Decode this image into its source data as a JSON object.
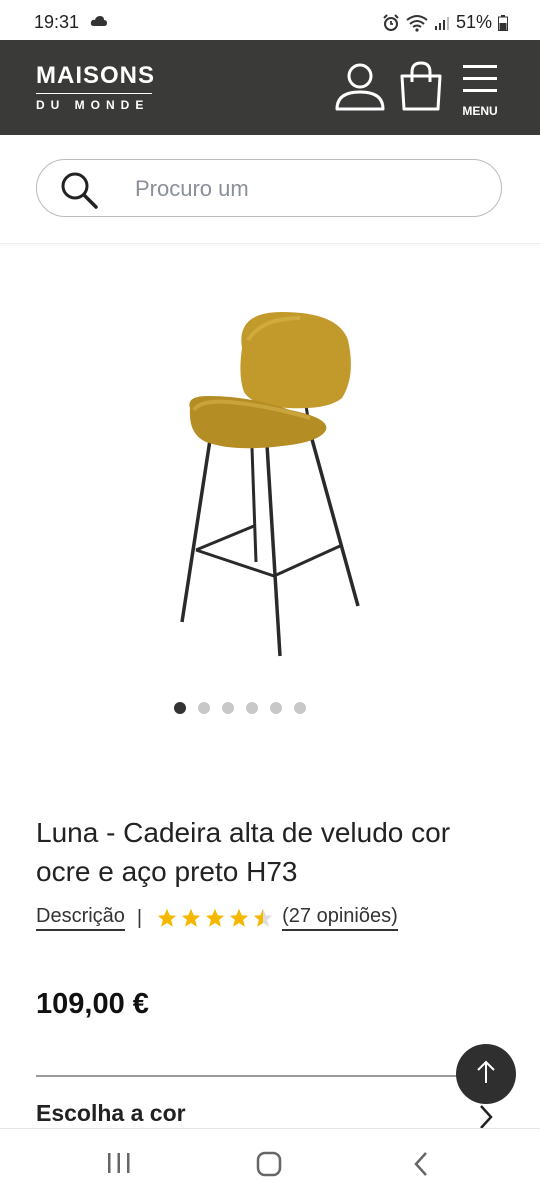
{
  "status_bar": {
    "time": "19:31",
    "battery": "51%"
  },
  "header": {
    "logo_top": "MAISONS",
    "logo_bottom": "DU MONDE",
    "menu_label": "MENU",
    "background": "#3a3a38"
  },
  "search": {
    "placeholder": "Procuro um"
  },
  "gallery": {
    "image_count": 6,
    "active_index": 0
  },
  "product": {
    "title": "Luna - Cadeira alta de veludo cor ocre e aço preto H73",
    "description_link": "Descrição",
    "separator": "|",
    "rating": 4.5,
    "rating_max": 5,
    "reviews_label": "(27 opiniões)",
    "price": "109,00 €",
    "choose_color_label": "Escolha a cor",
    "star_color": "#f5b800"
  },
  "icons": {
    "user": "user-icon",
    "bag": "shopping-bag-icon",
    "menu": "hamburger-menu-icon",
    "search": "search-icon",
    "scroll_top": "arrow-up-icon",
    "chevron": "chevron-right-icon"
  }
}
